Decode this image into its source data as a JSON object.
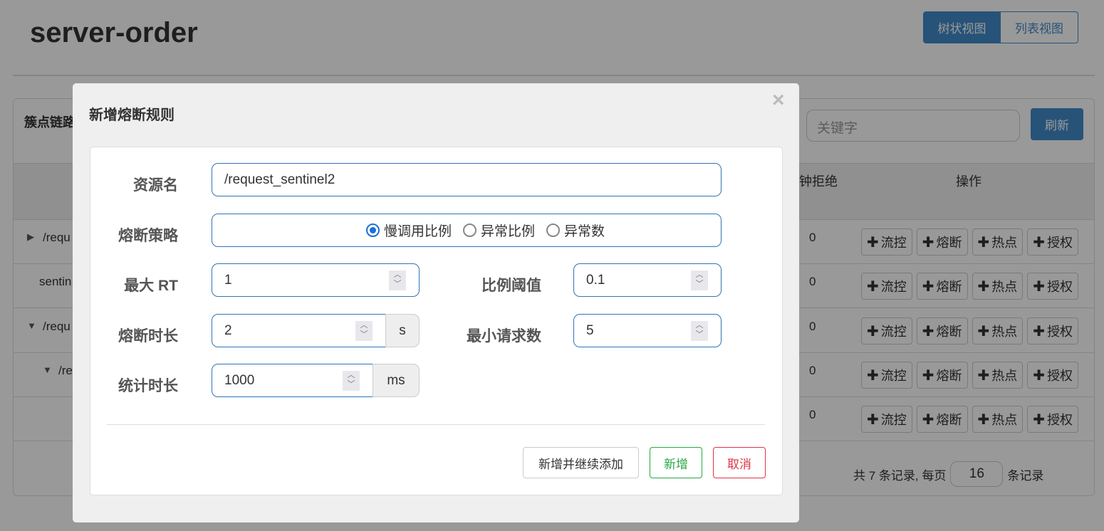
{
  "page": {
    "title": "server-order",
    "view_tree": "树状视图",
    "view_list": "列表视图"
  },
  "panel": {
    "title": "簇点链路",
    "search_placeholder": "关键字",
    "refresh": "刷新",
    "headers": {
      "reject": "分钟拒绝",
      "ops": "操作"
    },
    "rows": [
      {
        "resource": "/requ",
        "reject": "0",
        "expand": "collapsed"
      },
      {
        "resource": "sentin",
        "reject": "0",
        "expand": "none"
      },
      {
        "resource": "/requ",
        "reject": "0",
        "expand": "expanded"
      },
      {
        "resource": "/re",
        "reject": "0",
        "expand": "expanded"
      },
      {
        "resource": "",
        "reject": "0",
        "expand": "none"
      }
    ],
    "ops": [
      "流控",
      "熔断",
      "热点",
      "授权"
    ],
    "pager": {
      "prefix": "共 7 条记录, 每页",
      "page_size": "16",
      "suffix": "条记录"
    }
  },
  "modal": {
    "title": "新增熔断规则",
    "close": "×",
    "resource_label": "资源名",
    "resource_value": "/request_sentinel2",
    "strategy_label": "熔断策略",
    "strategies": [
      "慢调用比例",
      "异常比例",
      "异常数"
    ],
    "strategy_selected": "慢调用比例",
    "max_rt_label": "最大 RT",
    "max_rt_value": "1",
    "ratio_label": "比例阈值",
    "ratio_value": "0.1",
    "duration_label": "熔断时长",
    "duration_value": "2",
    "duration_unit": "s",
    "min_req_label": "最小请求数",
    "min_req_value": "5",
    "stat_label": "统计时长",
    "stat_value": "1000",
    "stat_unit": "ms",
    "btn_add_continue": "新增并继续添加",
    "btn_add": "新增",
    "btn_cancel": "取消"
  },
  "colors": {
    "primary": "#428bca",
    "success": "#28a745",
    "danger": "#dc3545"
  }
}
